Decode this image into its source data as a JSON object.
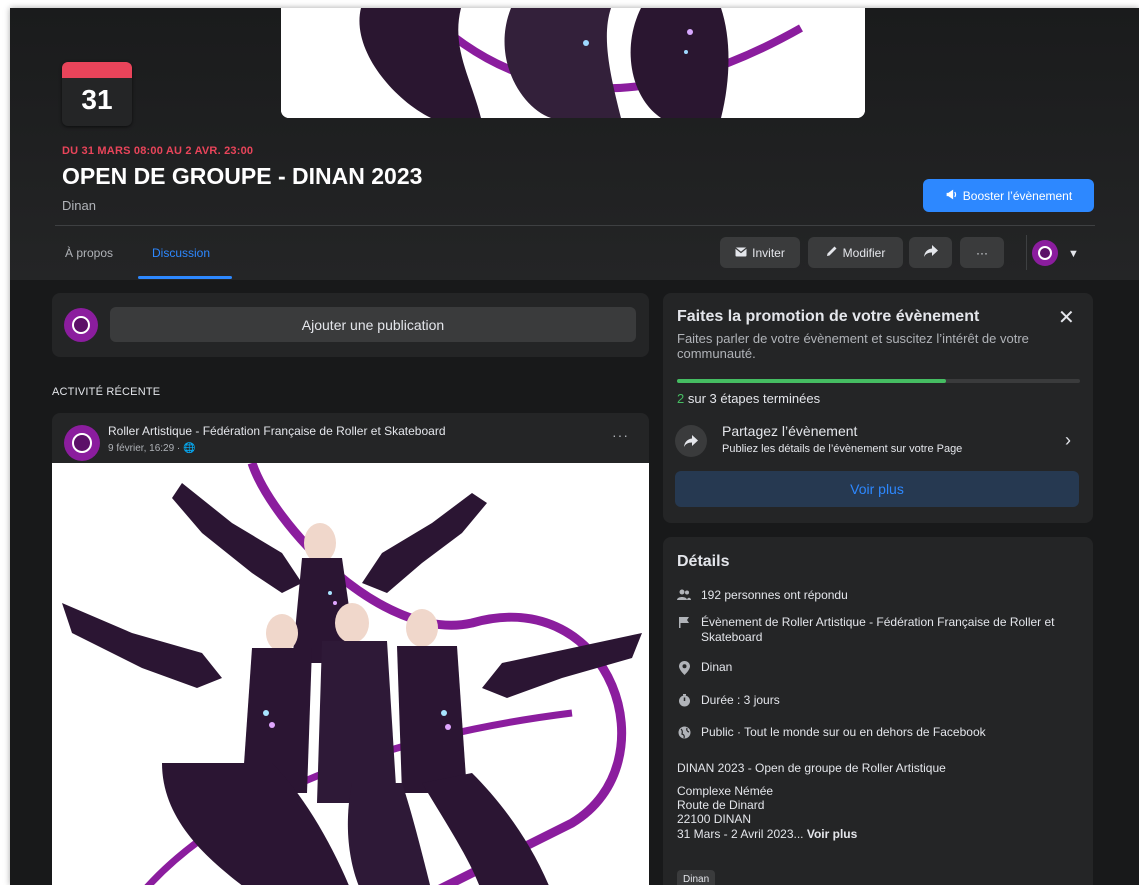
{
  "event": {
    "calendar_day": "31",
    "date_range": "DU 31 MARS 08:00 AU 2 AVR. 23:00",
    "title": "OPEN DE GROUPE - DINAN 2023",
    "location": "Dinan",
    "boost_label": "Booster l’évènement"
  },
  "tabs": [
    {
      "label": "À propos",
      "active": false
    },
    {
      "label": "Discussion",
      "active": true
    }
  ],
  "actions": {
    "invite_label": "Inviter",
    "edit_label": "Modifier",
    "more_label": "···"
  },
  "composer": {
    "placeholder": "Ajouter une publication"
  },
  "recent_activity_label": "ACTIVITÉ RÉCENTE",
  "post": {
    "author": "Roller Artistique - Fédération Française de Roller et Skateboard",
    "meta": "9 février, 16:29 · ",
    "more": "···"
  },
  "promo": {
    "title": "Faites la promotion de votre évènement",
    "description": "Faites parler de votre évènement et suscitez l’intérêt de votre communauté.",
    "progress_fraction": 0.667,
    "steps_done": "2",
    "steps_text": " sur 3 étapes terminées",
    "share_title": "Partagez l’évènement",
    "share_subtitle": "Publiez les détails de l’évènement sur votre Page",
    "see_more_label": "Voir plus"
  },
  "details": {
    "title": "Détails",
    "responses": "192 personnes ont répondu",
    "organizer": "Évènement de Roller Artistique - Fédération Française de Roller et Skateboard",
    "location": "Dinan",
    "duration": "Durée : 3 jours",
    "privacy": "Public · Tout le monde sur ou en dehors de Facebook",
    "description_line1": "DINAN 2023 - Open de groupe de Roller Artistique",
    "address_1": "Complexe Némée",
    "address_2": "Route de Dinard",
    "address_3": "22100 DINAN",
    "dates": "31 Mars - 2 Avril 2023... ",
    "see_more": "Voir plus",
    "tag": "Dinan"
  },
  "colors": {
    "background": "#18191a",
    "card": "#242526",
    "accent_blue": "#2d88ff",
    "date_red": "#e9445a",
    "progress_green": "#45bd62",
    "avatar_purple": "#8b1d9e"
  }
}
